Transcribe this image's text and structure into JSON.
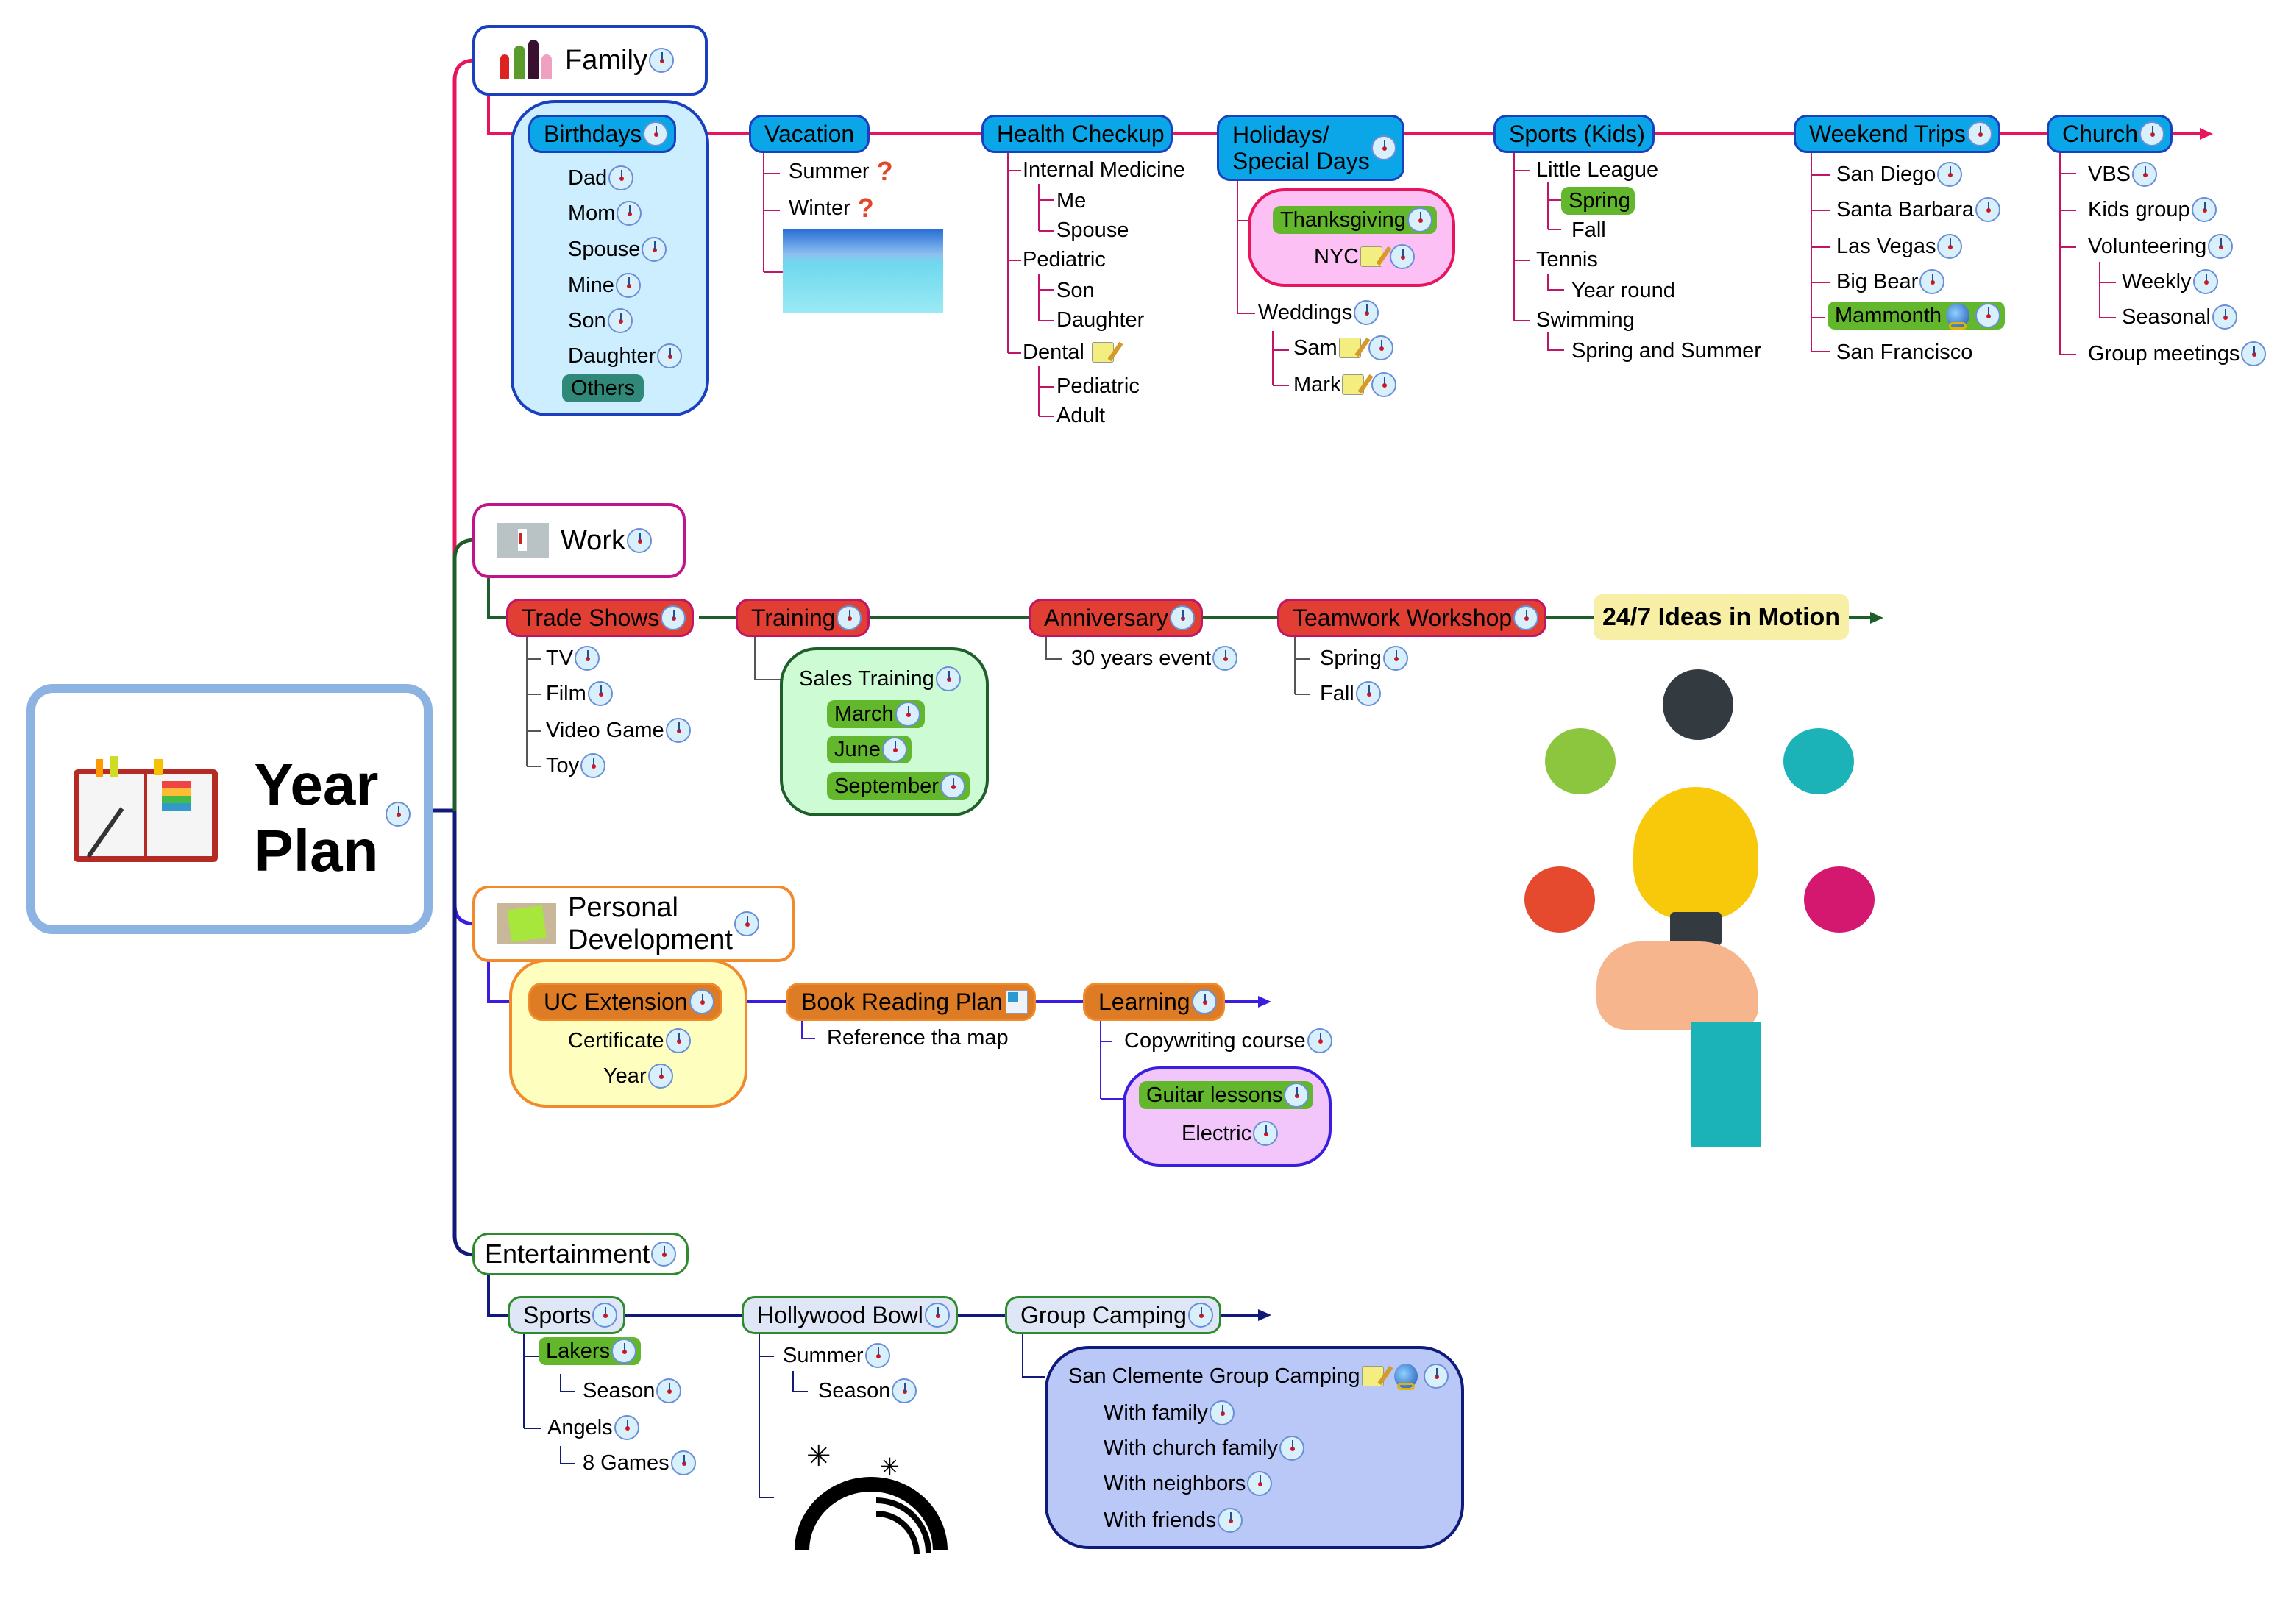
{
  "central": {
    "title_line1": "Year",
    "title_line2": "Plan",
    "image": "planner-notebook-image",
    "icon": "clock-icon"
  },
  "family": {
    "title": "Family",
    "image": "family-figures-image",
    "color": "#e8145c",
    "topics": [
      {
        "label": "Birthdays",
        "children": [
          "Dad",
          "Mom",
          "Spouse",
          "Mine",
          "Son",
          "Daughter",
          "Others"
        ]
      },
      {
        "label": "Vacation",
        "children": [
          "Summer",
          "Winter"
        ],
        "image": "ocean-image"
      },
      {
        "label": "Health Checkup",
        "children": [
          {
            "label": "Internal Medicine",
            "children": [
              "Me",
              "Spouse"
            ]
          },
          {
            "label": "Pediatric",
            "children": [
              "Son",
              "Daughter"
            ]
          },
          {
            "label": "Dental",
            "children": [
              "Pediatric",
              "Adult"
            ]
          }
        ]
      },
      {
        "label_line1": "Holidays/",
        "label_line2": "Special Days",
        "children": [
          {
            "label": "Thanksgiving",
            "children": [
              "NYC"
            ]
          },
          {
            "label": "Weddings",
            "children": [
              "Sam",
              "Mark"
            ]
          }
        ]
      },
      {
        "label": "Sports (Kids)",
        "children": [
          {
            "label": "Little League",
            "children": [
              "Spring",
              "Fall"
            ]
          },
          {
            "label": "Tennis",
            "children": [
              "Year round"
            ]
          },
          {
            "label": "Swimming",
            "children": [
              "Spring and Summer"
            ]
          }
        ]
      },
      {
        "label": "Weekend Trips",
        "children": [
          "San Diego",
          "Santa Barbara",
          "Las Vegas",
          "Big Bear",
          "Mammonth",
          "San Francisco"
        ]
      },
      {
        "label": "Church",
        "children": [
          "VBS",
          "Kids group",
          {
            "label": "Volunteering",
            "children": [
              "Weekly",
              "Seasonal"
            ]
          },
          "Group meetings"
        ]
      }
    ]
  },
  "work": {
    "title": "Work",
    "image": "busy-worker-image",
    "color": "#1e5e2a",
    "topics": [
      {
        "label": "Trade Shows",
        "children": [
          "TV",
          "Film",
          "Video Game",
          "Toy"
        ]
      },
      {
        "label": "Training",
        "children": [
          {
            "label": "Sales Training",
            "children": [
              "March",
              "June",
              "September"
            ]
          }
        ]
      },
      {
        "label": "Anniversary",
        "children": [
          "30 years event"
        ]
      },
      {
        "label": "Teamwork Workshop",
        "children": [
          "Spring",
          "Fall"
        ]
      },
      {
        "label": "24/7 Ideas in Motion"
      }
    ],
    "illustration": "lightbulb-hand-ideas-image"
  },
  "personal": {
    "title_line1": "Personal",
    "title_line2": "Development",
    "image": "make-things-happen-image",
    "color": "#3a1ee0",
    "topics": [
      {
        "label": "UC Extension",
        "children": [
          {
            "label": "Certificate",
            "children": [
              "Year"
            ]
          }
        ]
      },
      {
        "label": "Book Reading Plan",
        "children": [
          "Reference tha map"
        ]
      },
      {
        "label": "Learning",
        "children": [
          "Copywriting course",
          {
            "label": "Guitar lessons",
            "children": [
              "Electric"
            ]
          }
        ]
      }
    ]
  },
  "entertainment": {
    "title": "Entertainment",
    "color": "#0f1a7a",
    "topics": [
      {
        "label": "Sports",
        "children": [
          {
            "label": "Lakers",
            "children": [
              "Season"
            ]
          },
          {
            "label": "Angels",
            "children": [
              "8 Games"
            ]
          }
        ]
      },
      {
        "label": "Hollywood Bowl",
        "children": [
          {
            "label": "Summer",
            "children": [
              "Season"
            ]
          }
        ],
        "image": "hollywood-bowl-logo"
      },
      {
        "label": "Group Camping",
        "children": [
          {
            "label": "San Clemente Group Camping",
            "children": [
              "With family",
              "With church family",
              "With neighbors",
              "With friends"
            ]
          }
        ]
      }
    ]
  }
}
